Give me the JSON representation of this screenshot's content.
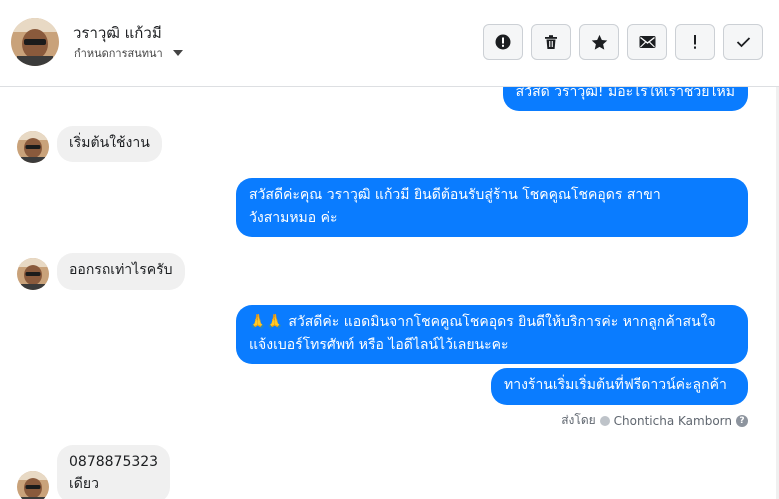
{
  "header": {
    "contact_name": "วราวุฒิ แก้วมี",
    "assign_label": "กำหนดการสนทนา",
    "buttons": [
      {
        "name": "mark-spam-button",
        "icon": "alert-circle-icon"
      },
      {
        "name": "delete-button",
        "icon": "trash-icon"
      },
      {
        "name": "star-button",
        "icon": "star-icon"
      },
      {
        "name": "mark-unread-button",
        "icon": "envelope-icon"
      },
      {
        "name": "follow-up-button",
        "icon": "exclamation-icon"
      },
      {
        "name": "mark-done-button",
        "icon": "checkmark-icon"
      }
    ]
  },
  "messages": [
    {
      "direction": "out",
      "lines": [
        "สวัสดี วราวุฒิ! มีอะไรให้เราช่วยไหม"
      ]
    },
    {
      "direction": "in",
      "lines": [
        "เริ่มต้นใช้งาน"
      ]
    },
    {
      "direction": "out",
      "lines": [
        "สวัสดีค่ะคุณ วราวุฒิ แก้วมี ยินดีต้อนรับสู่ร้าน โชคคูณโชคอุดร สาขา",
        "วังสามหมอ ค่ะ"
      ]
    },
    {
      "direction": "in",
      "lines": [
        "ออกรถเท่าไรครับ"
      ]
    },
    {
      "direction": "out",
      "emoji": "🙏🙏",
      "lines": [
        "สวัสดีค่ะ แอดมินจากโชคคูณโชคอุดร ยินดีให้บริการค่ะ หากลูกค้าสนใจ",
        "แจ้งเบอร์โทรศัพท์ หรือ ไอดีไลน์ไว้เลยนะคะ"
      ]
    },
    {
      "direction": "out",
      "lines": [
        "ทางร้านเริ่มเริ่มต้นที่ฟรีดาวน์ค่ะลูกค้า"
      ]
    },
    {
      "direction": "in",
      "lines": [
        "0878875323",
        "เดียว"
      ]
    }
  ],
  "sent_by": {
    "prefix": "ส่งโดย",
    "agent": "Chonticha Kamborn"
  },
  "colors": {
    "accent": "#0a7cff",
    "incoming_bubble": "#f0f0f0"
  }
}
